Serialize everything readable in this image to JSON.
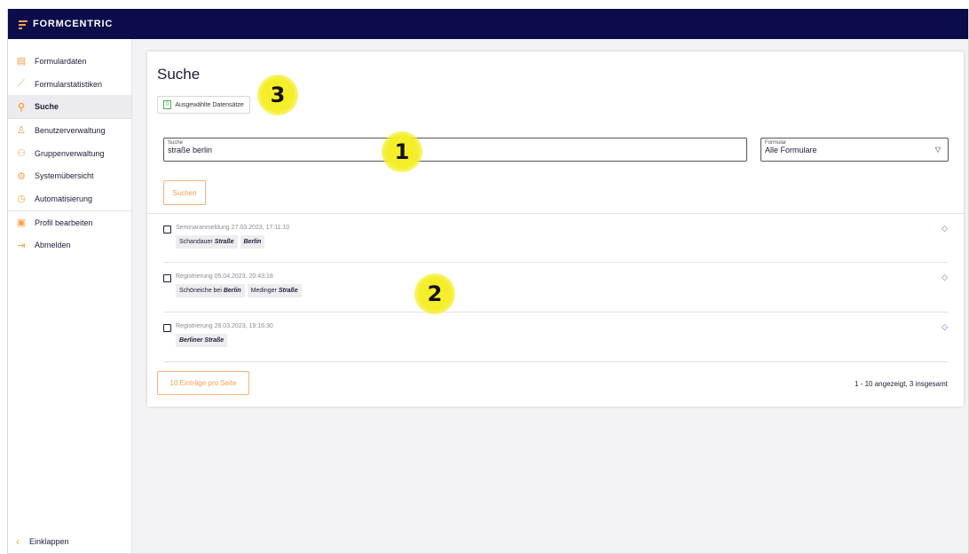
{
  "app": {
    "name": "FORMCENTRIC"
  },
  "sidebar": {
    "items": [
      {
        "label": "Formulardaten",
        "icon": "document-icon"
      },
      {
        "label": "Formularstatistiken",
        "icon": "chart-icon"
      },
      {
        "label": "Suche",
        "icon": "search-icon",
        "active": true
      },
      {
        "label": "Benutzerverwaltung",
        "icon": "user-icon"
      },
      {
        "label": "Gruppenverwaltung",
        "icon": "group-icon"
      },
      {
        "label": "Systemübersicht",
        "icon": "gear-icon"
      },
      {
        "label": "Automatisierung",
        "icon": "clock-icon"
      },
      {
        "label": "Profil bearbeiten",
        "icon": "profile-card-icon"
      },
      {
        "label": "Abmelden",
        "icon": "logout-icon"
      }
    ],
    "collapse_label": "Einklappen"
  },
  "main": {
    "title": "Suche",
    "selected": {
      "count": "0",
      "label": "Ausgewählte Datensätze"
    },
    "search": {
      "label": "Suche",
      "value": "straße berlin"
    },
    "form_select": {
      "label": "Formular",
      "value": "Alle Formulare"
    },
    "search_button": "Suchen",
    "results": [
      {
        "meta": "Seminaranmeldung 27.03.2023, 17:11:10",
        "chips": [
          {
            "pre": "Schandauer ",
            "em": "Straße"
          },
          {
            "pre": "",
            "em": "Berlin"
          }
        ]
      },
      {
        "meta": "Registrierung 05.04.2023, 20:43:18",
        "chips": [
          {
            "pre": "Schöneiche bei ",
            "em": "Berlin"
          },
          {
            "pre": "Medinger ",
            "em": "Straße"
          }
        ]
      },
      {
        "meta": "Registrierung 28.03.2023, 19:16:30",
        "chips": [
          {
            "pre": "",
            "em": "Berliner Straße"
          }
        ]
      }
    ],
    "per_page_button": "10 Einträge pro Seite",
    "pager_info": "1 - 10 angezeigt, 3 insgesamt"
  },
  "annotations": [
    "1",
    "2",
    "3"
  ],
  "colors": {
    "topbar": "#0c0c4a",
    "accent": "#f6a14b",
    "highlight": "#f5ee2a"
  }
}
